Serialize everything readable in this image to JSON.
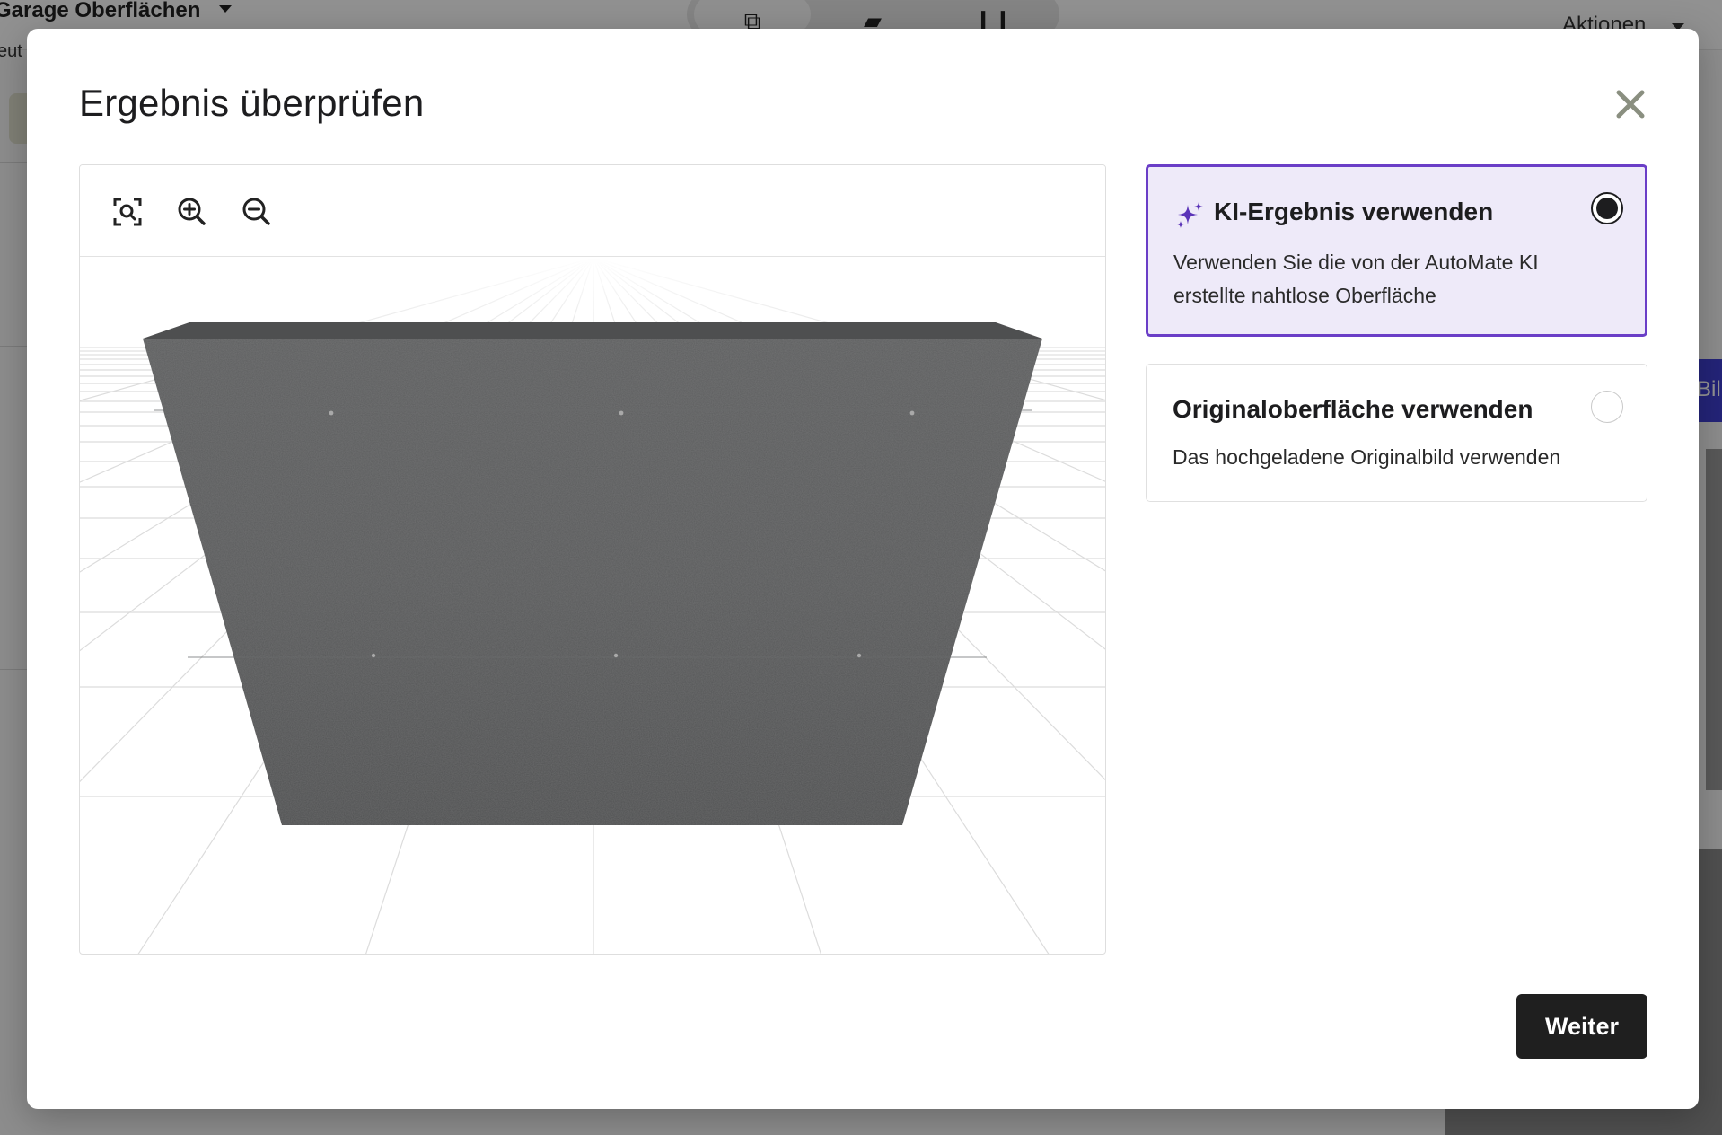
{
  "background": {
    "app_title": "Garage Oberflächen",
    "subtitle_fragment": "eut",
    "actions_label": "Aktionen",
    "side_button_fragment": "Bil"
  },
  "modal": {
    "title": "Ergebnis überprüfen",
    "close_icon": "close-icon",
    "viewer": {
      "tools": [
        "fit-view-icon",
        "zoom-in-icon",
        "zoom-out-icon"
      ]
    },
    "options": [
      {
        "id": "ai",
        "icon": "sparkle-icon",
        "title": "KI-Ergebnis verwenden",
        "description": "Verwenden Sie die von der AutoMate KI erstellte nahtlose Oberfläche",
        "selected": true
      },
      {
        "id": "original",
        "title": "Originaloberfläche verwenden",
        "description": "Das hochgeladene Originalbild verwenden",
        "selected": false
      }
    ],
    "next_label": "Weiter"
  },
  "colors": {
    "accent": "#6a3ec7",
    "selected_bg": "#eeeaf9",
    "primary_button": "#1f1f1f"
  }
}
